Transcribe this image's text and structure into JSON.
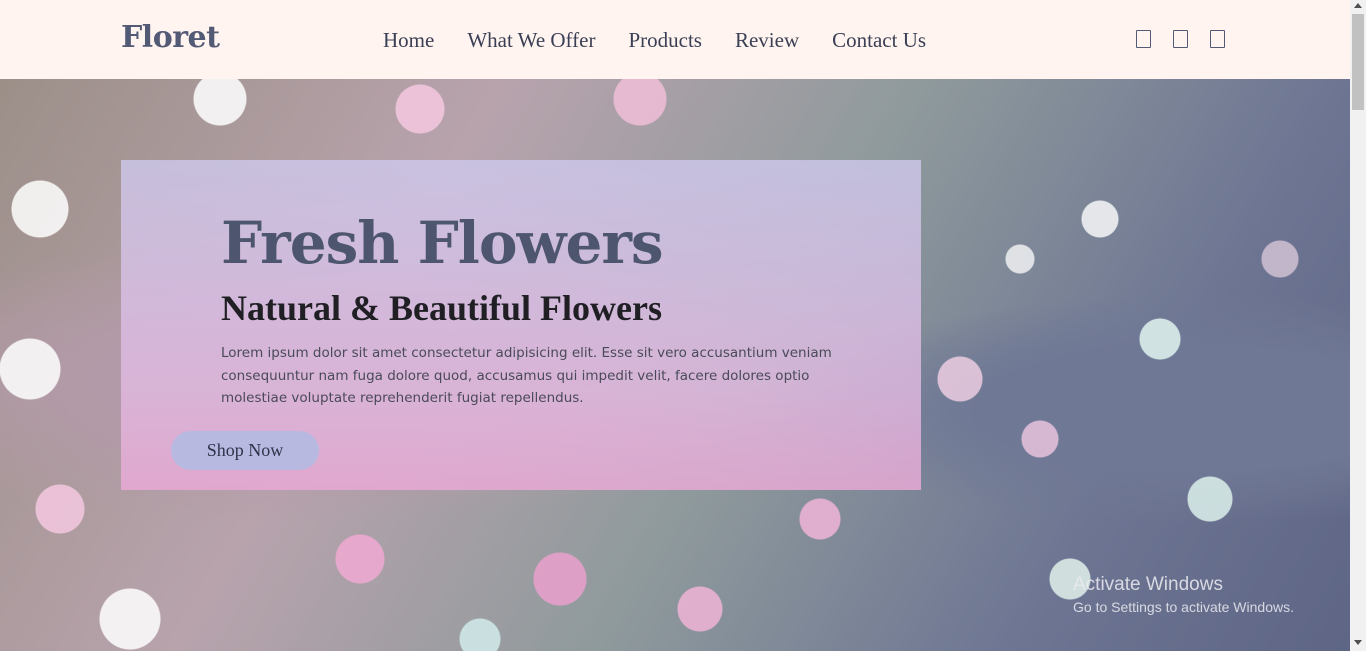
{
  "header": {
    "logo": "Floret",
    "nav": [
      {
        "label": "Home"
      },
      {
        "label": "What We Offer"
      },
      {
        "label": "Products"
      },
      {
        "label": "Review"
      },
      {
        "label": "Contact Us"
      }
    ],
    "icons": [
      "heart-icon",
      "cart-icon",
      "user-icon"
    ]
  },
  "hero": {
    "title": "Fresh Flowers",
    "subtitle": "Natural & Beautiful Flowers",
    "text": "Lorem ipsum dolor sit amet consectetur adipisicing elit. Esse sit vero accusantium veniam consequuntur nam fuga dolore quod, accusamus qui impedit velit, facere dolores optio molestiae voluptate reprehenderit fugiat repellendus.",
    "button": "Shop Now"
  },
  "watermark": {
    "line1": "Activate Windows",
    "line2": "Go to Settings to activate Windows."
  },
  "colors": {
    "header_bg": "#fff4ef",
    "title": "#4e566f",
    "button_bg": "#b7b9e1"
  }
}
